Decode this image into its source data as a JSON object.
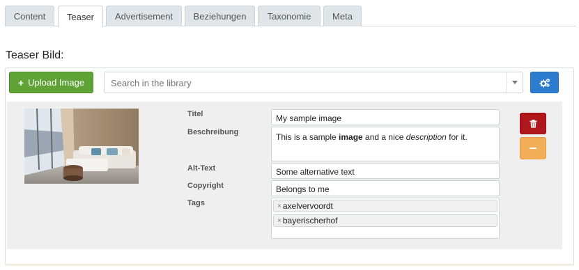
{
  "tabs": [
    {
      "label": "Content",
      "active": false
    },
    {
      "label": "Teaser",
      "active": true
    },
    {
      "label": "Advertisement",
      "active": false
    },
    {
      "label": "Beziehungen",
      "active": false
    },
    {
      "label": "Taxonomie",
      "active": false
    },
    {
      "label": "Meta",
      "active": false
    }
  ],
  "section": {
    "title": "Teaser Bild:"
  },
  "toolbar": {
    "upload_label": "Upload Image",
    "search_placeholder": "Search in the library",
    "settings_icon": "gears-icon"
  },
  "image_item": {
    "thumbnail_alt": "Living room with sofa and round side table",
    "fields": {
      "title": {
        "label": "Titel",
        "value": "My sample image"
      },
      "description": {
        "label": "Beschreibung",
        "value_before": "This is a sample ",
        "value_bold": "image",
        "value_middle": " and a nice ",
        "value_italic": "description",
        "value_after": " for it."
      },
      "alt": {
        "label": "Alt-Text",
        "value": "Some alternative text"
      },
      "copyright": {
        "label": "Copyright",
        "value": "Belongs to me"
      },
      "tags": {
        "label": "Tags",
        "items": [
          "axelvervoordt",
          "bayerischerhof"
        ]
      }
    },
    "actions": {
      "delete_icon": "trash-icon",
      "collapse_icon": "minus-icon"
    }
  },
  "colors": {
    "upload": "#5fa336",
    "settings": "#2c7cd0",
    "delete": "#b0171d",
    "collapse": "#f2ae58"
  }
}
